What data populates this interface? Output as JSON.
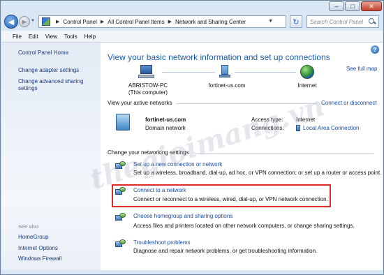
{
  "window_controls": {
    "minimize": "–",
    "maximize": "□",
    "close": "✕"
  },
  "address_bar": {
    "breadcrumbs": [
      "Control Panel",
      "All Control Panel Items",
      "Network and Sharing Center"
    ],
    "search_placeholder": "Search Control Panel"
  },
  "menu": [
    "File",
    "Edit",
    "View",
    "Tools",
    "Help"
  ],
  "sidebar": {
    "home": "Control Panel Home",
    "links": [
      "Change adapter settings",
      "Change advanced sharing settings"
    ],
    "see_also_heading": "See also",
    "see_also": [
      "HomeGroup",
      "Internet Options",
      "Windows Firewall"
    ]
  },
  "main": {
    "title": "View your basic network information and set up connections",
    "see_full_map": "See full map",
    "map": {
      "computer_name": "ABRISTOW-PC",
      "computer_sub": "(This computer)",
      "network": "fortinet-us.com",
      "internet": "Internet"
    },
    "active_heading": "View your active networks",
    "connect_disconnect": "Connect or disconnect",
    "active_network": {
      "name": "fortinet-us.com",
      "category": "Domain network",
      "access_type_label": "Access type:",
      "access_type_value": "Internet",
      "connections_label": "Connections:",
      "connections_value": "Local Area Connection"
    },
    "change_heading": "Change your networking settings",
    "tasks": [
      {
        "title": "Set up a new connection or network",
        "desc": "Set up a wireless, broadband, dial-up, ad hoc, or VPN connection; or set up a router or access point."
      },
      {
        "title": "Connect to a network",
        "desc": "Connect or reconnect to a wireless, wired, dial-up, or VPN network connection."
      },
      {
        "title": "Choose homegroup and sharing options",
        "desc": "Access files and printers located on other network computers, or change sharing settings."
      },
      {
        "title": "Troubleshoot problems",
        "desc": "Diagnose and repair network problems, or get troubleshooting information."
      }
    ]
  },
  "watermark": "thegioimang.vn"
}
